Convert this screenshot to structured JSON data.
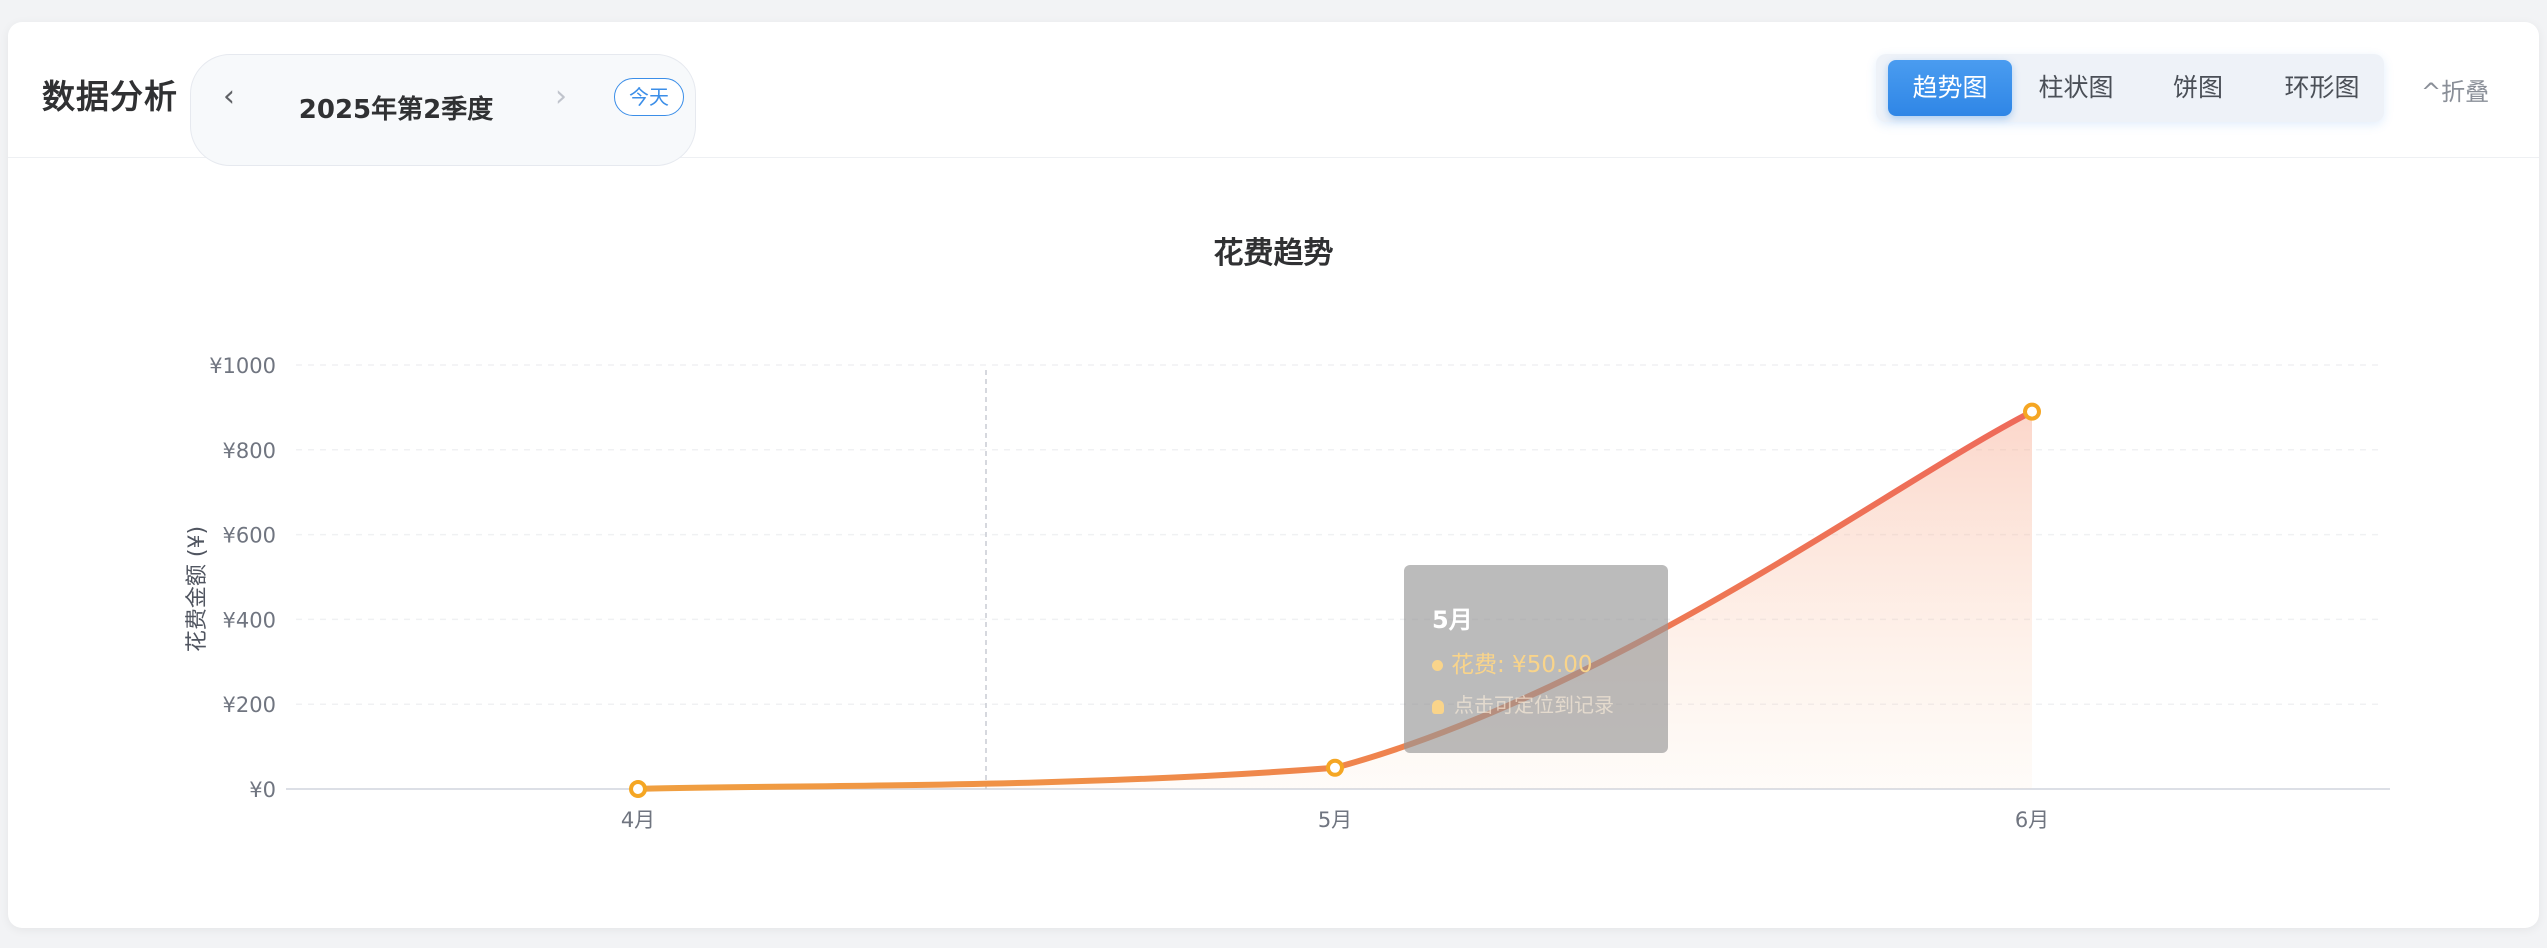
{
  "header": {
    "title": "数据分析",
    "period_label": "2025年第2季度",
    "today_label": "今天",
    "prev_icon": "chevron-left-icon",
    "next_icon": "chevron-right-icon",
    "tabs": [
      {
        "label": "趋势图",
        "active": true
      },
      {
        "label": "柱状图",
        "active": false
      },
      {
        "label": "饼图",
        "active": false
      },
      {
        "label": "环形图",
        "active": false
      }
    ],
    "collapse_label": "^折叠"
  },
  "tooltip": {
    "title": "5月",
    "value_text": "花费: ¥50.00",
    "hint": "点击可定位到记录"
  },
  "colors": {
    "accent": "#3b8ee8",
    "line_start": "#f0a040",
    "line_end": "#ee6a5a",
    "point": "#f5a623"
  },
  "chart_data": {
    "type": "line",
    "title": "花费趋势",
    "ylabel": "花费金额 (¥)",
    "xlabel": "",
    "categories": [
      "4月",
      "5月",
      "6月"
    ],
    "series": [
      {
        "name": "花费",
        "values": [
          0,
          50,
          890
        ]
      }
    ],
    "ylim": [
      0,
      1000
    ],
    "yticks": [
      0,
      200,
      400,
      600,
      800,
      1000
    ],
    "ytick_labels": [
      "¥0",
      "¥200",
      "¥400",
      "¥600",
      "¥800",
      "¥1000"
    ],
    "grid": true,
    "smooth": true,
    "area_fill": true
  }
}
